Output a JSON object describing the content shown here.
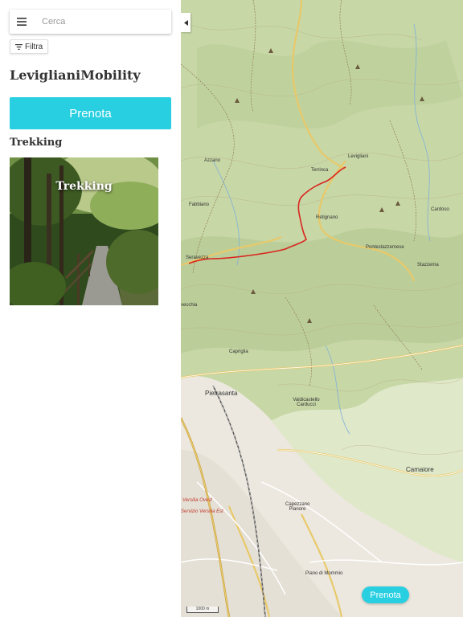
{
  "search": {
    "placeholder": "Cerca"
  },
  "filter": {
    "label": "Filtra"
  },
  "brand": {
    "name": "LeviglianiMobility"
  },
  "book_button": {
    "label": "Prenota"
  },
  "section": {
    "title": "Trekking"
  },
  "card": {
    "title": "Trekking"
  },
  "map": {
    "labels": {
      "levigliani": "Levigliani",
      "terrinca": "Terrinca",
      "azzano": "Azzano",
      "fabbiano": "Fabbiano",
      "retignano": "Retignano",
      "seravezza": "Seravezza",
      "pontestazzemese": "Pontestazzemese",
      "stazzema": "Stazzema",
      "cardoso": "Cardoso",
      "capriglia": "Capriglia",
      "pietrasanta": "Pietrasanta",
      "valdicastello": "Valdicastello Carducci",
      "camaiore": "Camaiore",
      "capezzano": "Capezzano Pianore",
      "piano_di_mommio": "Piano di Mommio",
      "versilia_ovest": "Versilia Ovest",
      "versilia_est": "Servizio Versilia Est",
      "vecchia": "vecchia"
    },
    "scale": "1000 m",
    "book_label": "Prenota"
  },
  "colors": {
    "accent": "#28cfe1",
    "route": "#d9251f"
  }
}
